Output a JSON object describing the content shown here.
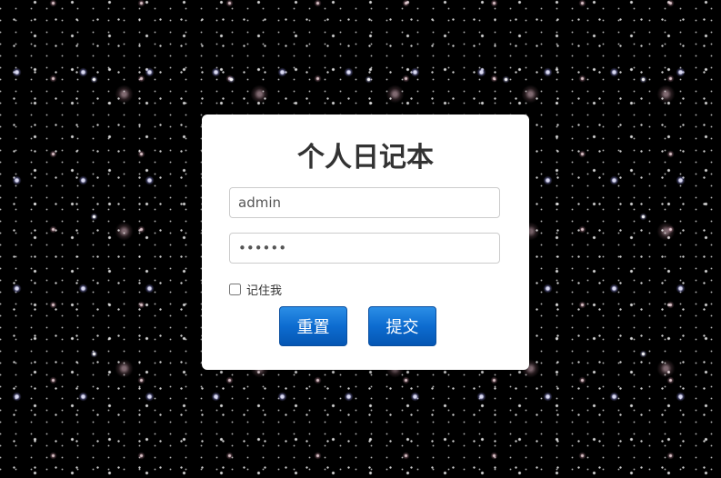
{
  "login": {
    "title": "个人日记本",
    "username_value": "admin",
    "password_value": "••••••",
    "remember_label": "记住我",
    "remember_checked": false,
    "reset_label": "重置",
    "submit_label": "提交"
  },
  "colors": {
    "background": "#000000",
    "card": "#ffffff",
    "title": "#333333",
    "button": "#0d6cd0",
    "button_text": "#ffffff"
  }
}
